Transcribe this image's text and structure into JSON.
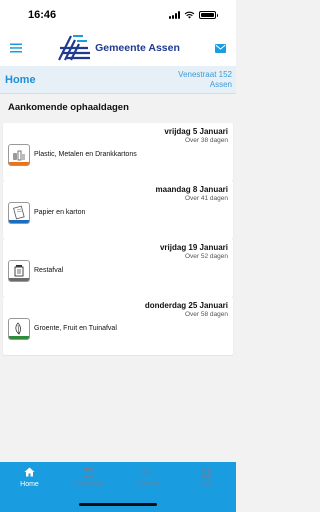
{
  "status_bar": {
    "time": "16:46"
  },
  "header": {
    "logo_text": "Gemeente Assen"
  },
  "title_bar": {
    "title": "Home",
    "address_line1": "Venestraat 152",
    "address_line2": "Assen"
  },
  "section_title": "Aankomende ophaaldagen",
  "pickups": [
    {
      "date": "vrijdag 5 Januari",
      "days": "Over 38 dagen",
      "label": "Plastic, Metalen en Drankkartons",
      "color": "#e8731c"
    },
    {
      "date": "maandag 8 Januari",
      "days": "Over 41 dagen",
      "label": "Papier en karton",
      "color": "#1b6dc1"
    },
    {
      "date": "vrijdag 19 Januari",
      "days": "Over 52 dagen",
      "label": "Restafval",
      "color": "#6b6b6b"
    },
    {
      "date": "donderdag 25 Januari",
      "days": "Over 58 dagen",
      "label": "Groente, Fruit en Tuinafval",
      "color": "#2e8b3a"
    }
  ],
  "tabs": [
    {
      "label": "Home",
      "icon": "home-icon"
    },
    {
      "label": "Afvalkalender",
      "icon": "calendar-icon"
    },
    {
      "label": "Afvalwijzer",
      "icon": "search-list-icon"
    },
    {
      "label": "Kaart",
      "icon": "map-icon"
    }
  ],
  "colors": {
    "accent": "#1a9de0",
    "title_text": "#1d8fd6",
    "brand": "#1f3a8f"
  }
}
